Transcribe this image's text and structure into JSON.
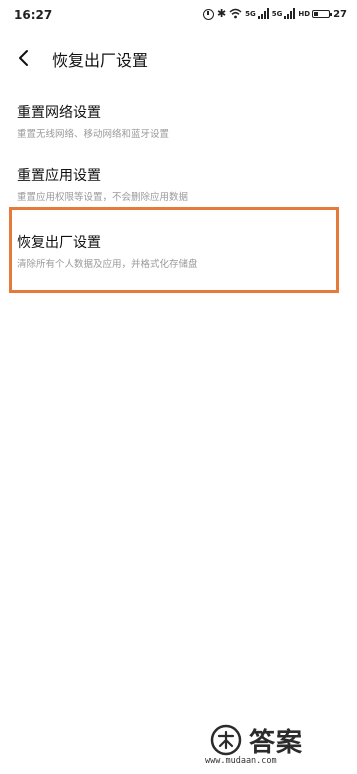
{
  "status_bar": {
    "time": "16:27",
    "signal_labels": [
      "5G",
      "5G",
      "HD"
    ],
    "battery": "27",
    "battery_level": 0.27
  },
  "header": {
    "title": "恢复出厂设置"
  },
  "settings_list": [
    {
      "title": "重置网络设置",
      "subtitle": "重置无线网络、移动网络和蓝牙设置"
    },
    {
      "title": "重置应用设置",
      "subtitle": "重置应用权限等设置，不会删除应用数据"
    },
    {
      "title": "恢复出厂设置",
      "subtitle": "清除所有个人数据及应用，并格式化存储盘"
    }
  ],
  "highlight": {
    "color": "#e57a3b",
    "target_item": 2
  },
  "watermark": {
    "text": "答案",
    "url": "www.mudaan.com"
  },
  "icons": {
    "back": "chevron-left-icon",
    "alarm": "alarm-icon",
    "bluetooth": "bluetooth-icon",
    "wifi": "wifi-icon",
    "signal": "signal-icon",
    "battery": "battery-icon"
  }
}
